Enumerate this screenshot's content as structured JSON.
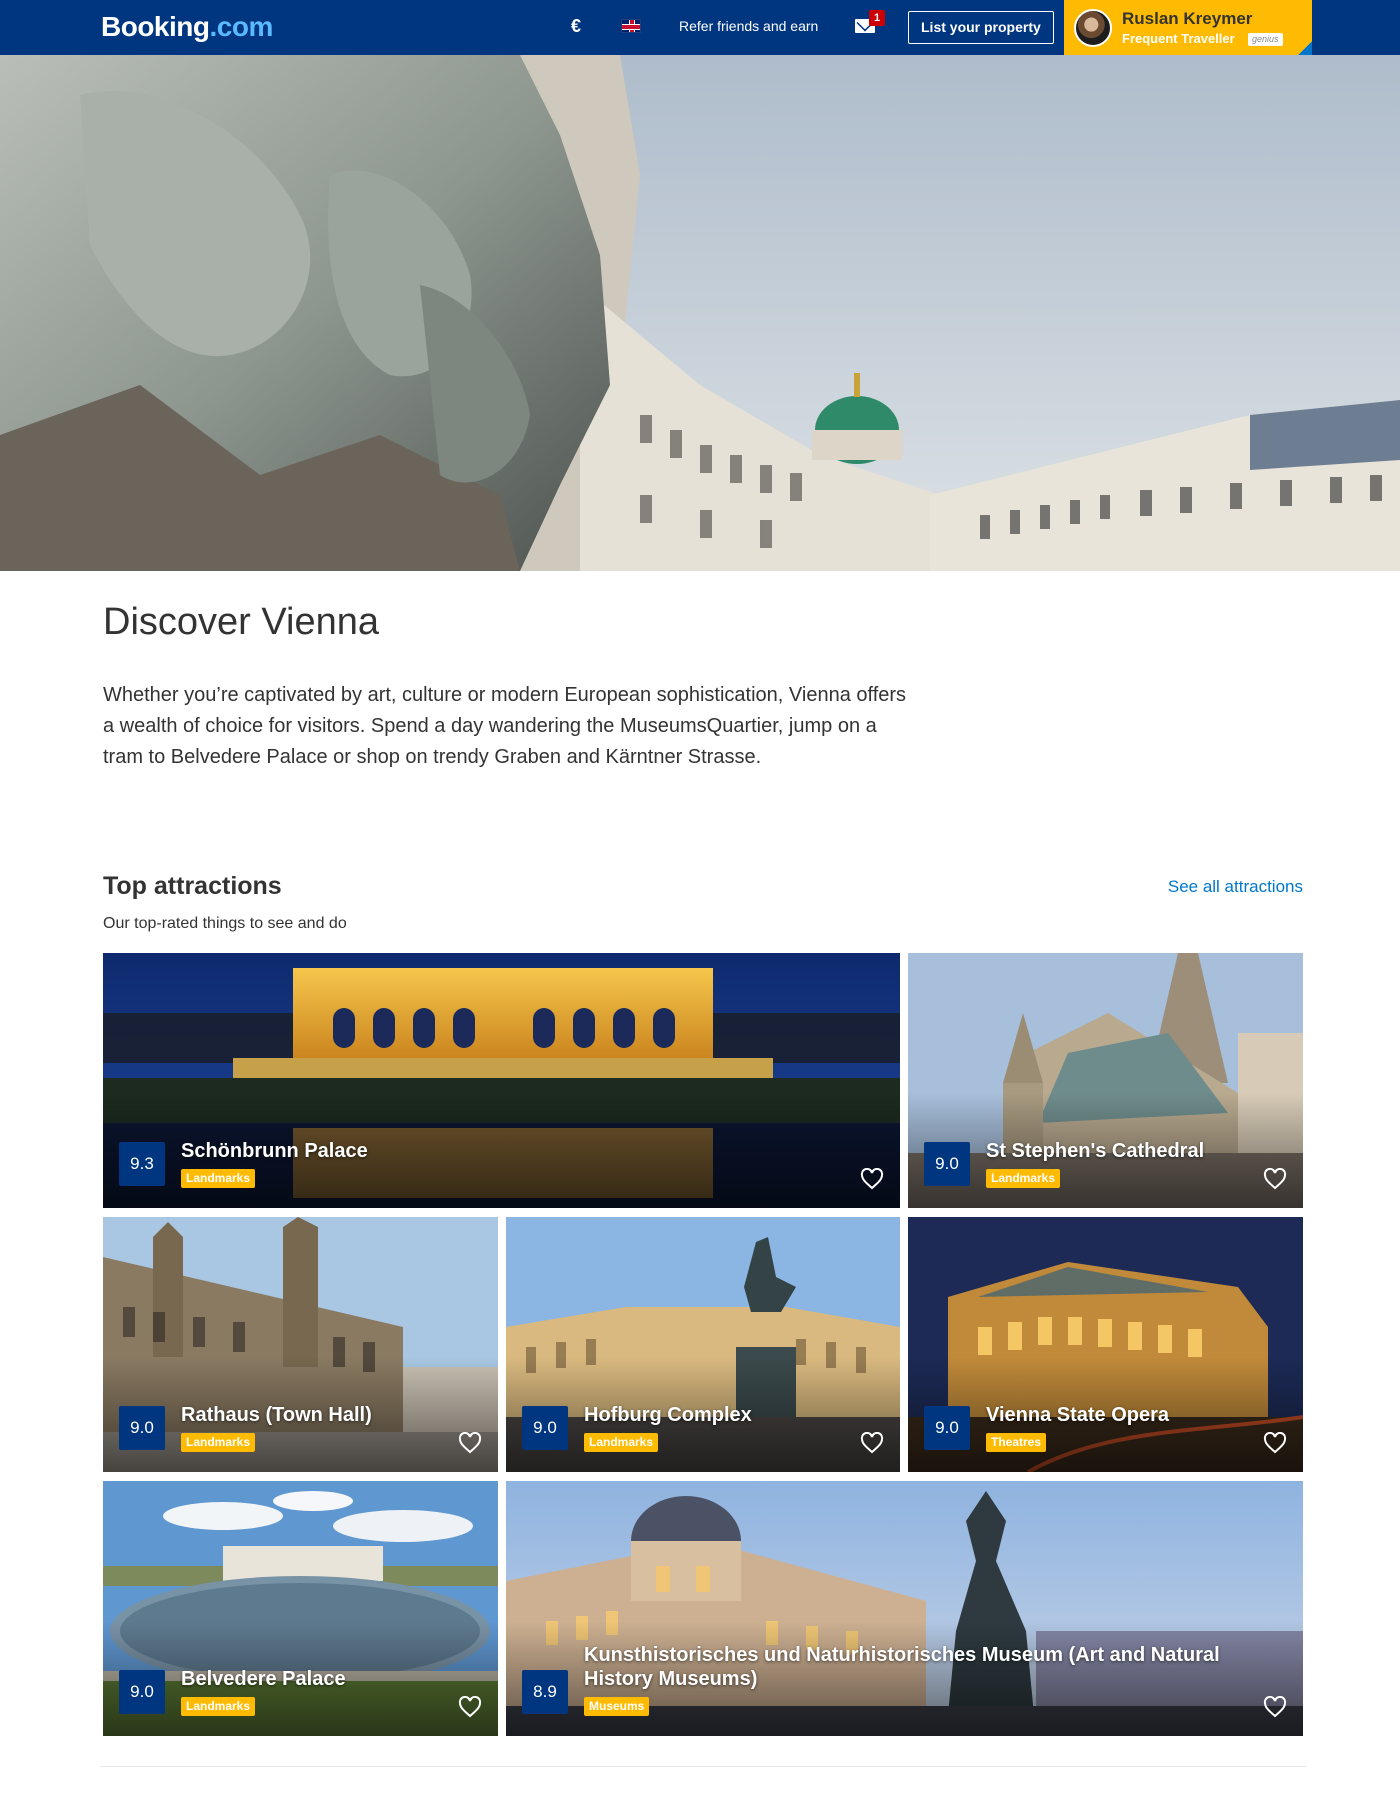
{
  "header": {
    "logo_text": "Booking",
    "logo_suffix": ".com",
    "currency": "€",
    "refer_label": "Refer friends and earn",
    "inbox_count": "1",
    "list_property_label": "List your property",
    "profile": {
      "name": "Ruslan Kreymer",
      "tier": "Frequent Traveller",
      "badge": "genius"
    }
  },
  "icons": {
    "flag": "uk-flag-icon",
    "mail": "mail-icon",
    "heart": "heart-icon"
  },
  "colors": {
    "brand_blue": "#003580",
    "accent_yellow": "#febb02",
    "link_blue": "#0077cc"
  },
  "page": {
    "title": "Discover Vienna",
    "intro": "Whether you’re captivated by art, culture or modern European sophistication, Vienna offers a wealth of choice for visitors. Spend a day wandering the MuseumsQuartier, jump on a tram to Belvedere Palace or shop on trendy Graben and Kärntner Strasse."
  },
  "attractions": {
    "title": "Top attractions",
    "subtitle": "Our top-rated things to see and do",
    "see_all": "See all attractions",
    "items": [
      {
        "name": "Schönbrunn Palace",
        "category": "Landmarks",
        "score": "9.3"
      },
      {
        "name": "St Stephen's Cathedral",
        "category": "Landmarks",
        "score": "9.0"
      },
      {
        "name": "Rathaus (Town Hall)",
        "category": "Landmarks",
        "score": "9.0"
      },
      {
        "name": "Hofburg Complex",
        "category": "Landmarks",
        "score": "9.0"
      },
      {
        "name": "Vienna State Opera",
        "category": "Theatres",
        "score": "9.0"
      },
      {
        "name": "Belvedere Palace",
        "category": "Landmarks",
        "score": "9.0"
      },
      {
        "name": "Kunsthistorisches und Naturhistorisches Museum (Art and Natural History Museums)",
        "category": "Museums",
        "score": "8.9"
      }
    ]
  }
}
